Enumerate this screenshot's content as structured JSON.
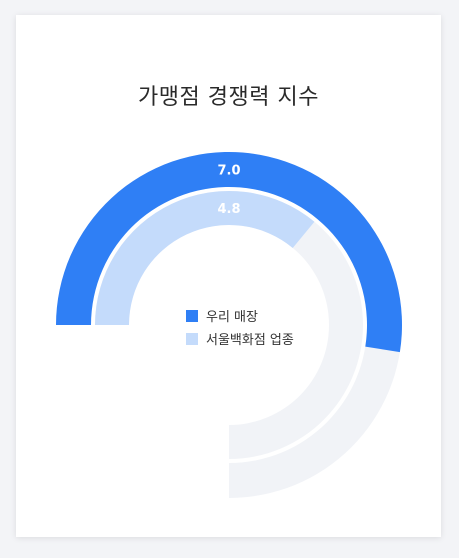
{
  "chart_data": {
    "type": "radial-bar",
    "title": "가맹점 경쟁력 지수",
    "max": 10,
    "series": [
      {
        "name": "우리 매장",
        "value": 7.0,
        "label": "7.0",
        "color": "#2f7ff5"
      },
      {
        "name": "서울백화점 업종",
        "value": 4.8,
        "label": "4.8",
        "color": "#c4dbfb"
      }
    ],
    "track_color": "#f1f3f7"
  }
}
